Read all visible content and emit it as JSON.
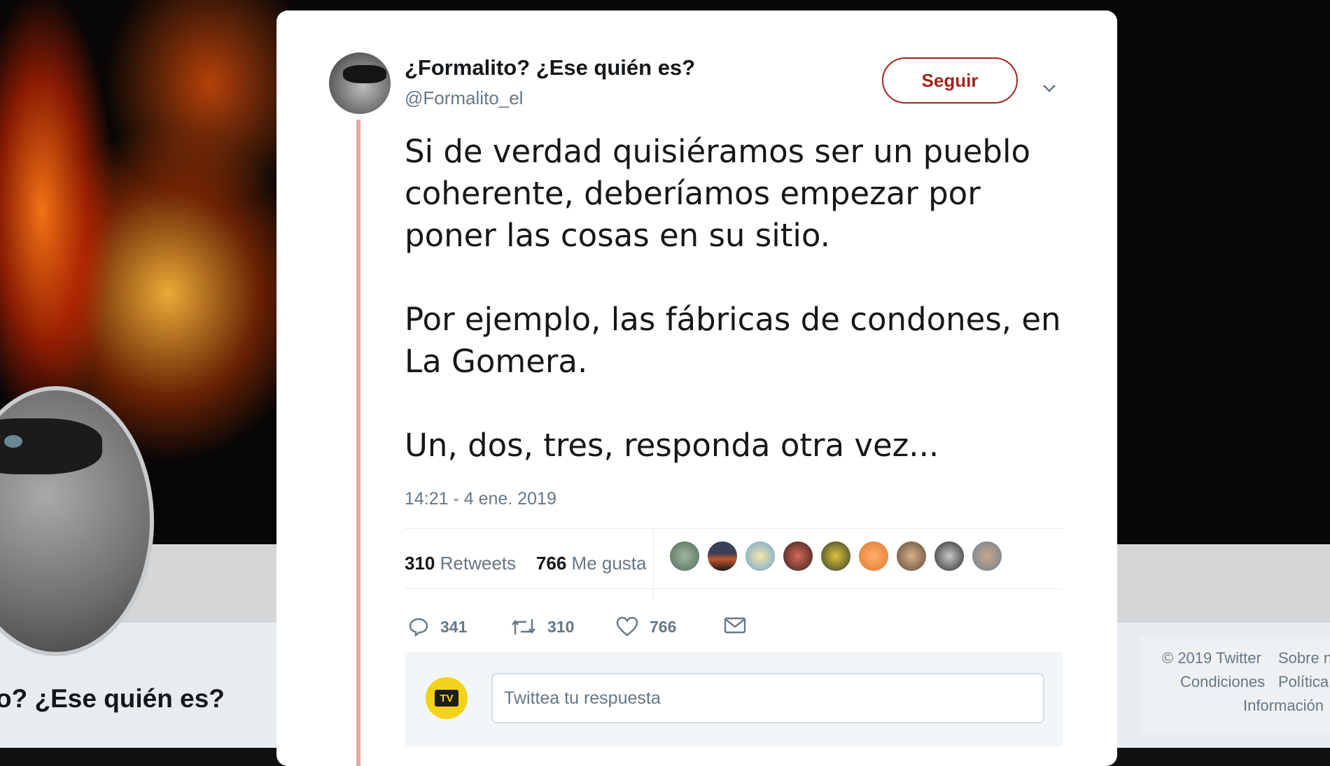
{
  "profile": {
    "name_fragment": "o? ¿Ese quién es?"
  },
  "footer": {
    "links": [
      "© 2019 Twitter",
      "Sobre n",
      "Condiciones",
      "Política",
      "Información"
    ]
  },
  "tweet": {
    "author_name": "¿Formalito? ¿Ese quién es?",
    "author_handle": "@Formalito_el",
    "follow_label": "Seguir",
    "text_lines": [
      "Si de verdad quisiéramos ser un pueblo",
      "coherente, deberíamos empezar por",
      "poner las cosas en su sitio.",
      "Por ejemplo, las fábricas de condones, en",
      "La Gomera.",
      "Un, dos, tres, responda otra vez..."
    ],
    "timestamp": "14:21 - 4 ene. 2019",
    "retweets_count": "310",
    "retweets_label": "Retweets",
    "likes_count": "766",
    "likes_label": "Me gusta",
    "actions": {
      "reply": "341",
      "retweet": "310",
      "like": "766"
    },
    "reply_placeholder": "Twittea tu respuesta",
    "reply_avatar_text": "TV"
  },
  "colors": {
    "follow_accent": "#a0261d",
    "thread_line": "#e3a99f",
    "muted_text": "#657786"
  },
  "icons": [
    "chevron-down-icon",
    "reply-icon",
    "retweet-icon",
    "heart-icon",
    "mail-icon"
  ]
}
